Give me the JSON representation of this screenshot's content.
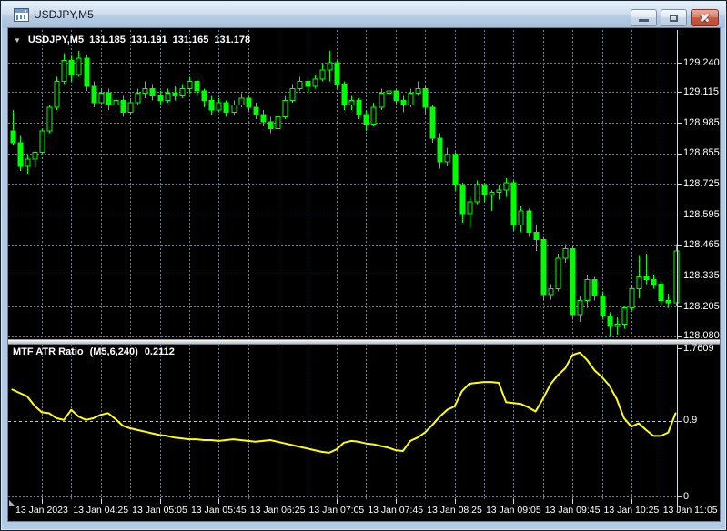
{
  "window": {
    "title": "USDJPY,M5"
  },
  "icons": {
    "app": "chart-window",
    "symbol_dropdown": "▼",
    "minimize": "minimize-bar",
    "restore": "restore-square",
    "close": "close-x"
  },
  "main_chart": {
    "info_bar": {
      "symbol": "USDJPY,M5",
      "open": "131.185",
      "high": "131.191",
      "low": "131.165",
      "close": "131.178"
    }
  },
  "indicator": {
    "name": "MTF ATR Ratio",
    "params": "(M5,6,240)",
    "value": "0.2112"
  },
  "colors": {
    "background": "#000000",
    "candle": "#00ff00",
    "bull_fill": "#000000",
    "bear_fill": "#00ff00",
    "indicator_line": "#ffff00",
    "grid": "#6e8090",
    "level_line": "#c0c6cc",
    "axis_line": "#d4d9dd",
    "axis_text": "#ffffff",
    "titlebar_text": "#15191d",
    "close_button": "#c65940"
  },
  "chart_data": [
    {
      "type": "candlestick",
      "title": "USDJPY,M5",
      "ylabel": "price",
      "y_ticks": [
        "129.240",
        "129.115",
        "128.985",
        "128.855",
        "128.725",
        "128.595",
        "128.465",
        "128.335",
        "128.205",
        "128.080"
      ],
      "x_labels": [
        "13 Jan 2023",
        "13 Jan 04:25",
        "13 Jan 05:05",
        "13 Jan 05:45",
        "13 Jan 06:25",
        "13 Jan 07:05",
        "13 Jan 07:45",
        "13 Jan 08:25",
        "13 Jan 09:05",
        "13 Jan 09:45",
        "13 Jan 10:25",
        "13 Jan 11:05"
      ],
      "grid": true,
      "candles": [
        [
          128.95,
          129.04,
          128.89,
          128.9
        ],
        [
          128.9,
          128.93,
          128.78,
          128.8
        ],
        [
          128.8,
          128.85,
          128.77,
          128.83
        ],
        [
          128.83,
          128.87,
          128.8,
          128.86
        ],
        [
          128.86,
          128.96,
          128.85,
          128.95
        ],
        [
          128.95,
          129.06,
          128.94,
          129.05
        ],
        [
          129.05,
          129.18,
          129.04,
          129.16
        ],
        [
          129.16,
          129.28,
          129.15,
          129.25
        ],
        [
          129.25,
          129.27,
          129.16,
          129.19
        ],
        [
          129.19,
          129.29,
          129.18,
          129.26
        ],
        [
          129.26,
          129.27,
          129.12,
          129.14
        ],
        [
          129.14,
          129.16,
          129.05,
          129.07
        ],
        [
          129.07,
          129.13,
          129.06,
          129.11
        ],
        [
          129.11,
          129.13,
          129.04,
          129.06
        ],
        [
          129.06,
          129.1,
          129.02,
          129.08
        ],
        [
          129.08,
          129.1,
          129.01,
          129.03
        ],
        [
          129.03,
          129.09,
          129.02,
          129.07
        ],
        [
          129.07,
          129.13,
          129.06,
          129.11
        ],
        [
          129.11,
          129.16,
          129.09,
          129.13
        ],
        [
          129.13,
          129.15,
          129.08,
          129.1
        ],
        [
          129.1,
          129.12,
          129.06,
          129.08
        ],
        [
          129.08,
          129.13,
          129.07,
          129.11
        ],
        [
          129.11,
          129.14,
          129.08,
          129.1
        ],
        [
          129.1,
          129.15,
          129.09,
          129.13
        ],
        [
          129.13,
          129.18,
          129.11,
          129.16
        ],
        [
          129.16,
          129.17,
          129.1,
          129.12
        ],
        [
          129.12,
          129.13,
          129.05,
          129.08
        ],
        [
          129.08,
          129.1,
          129.02,
          129.04
        ],
        [
          129.04,
          129.09,
          129.03,
          129.07
        ],
        [
          129.07,
          129.08,
          129.01,
          129.03
        ],
        [
          129.03,
          129.08,
          129.02,
          129.06
        ],
        [
          129.06,
          129.11,
          129.05,
          129.09
        ],
        [
          129.09,
          129.1,
          129.03,
          129.05
        ],
        [
          129.05,
          129.07,
          129.0,
          129.02
        ],
        [
          129.02,
          129.04,
          128.97,
          128.99
        ],
        [
          128.99,
          129.01,
          128.94,
          128.96
        ],
        [
          128.96,
          129.02,
          128.95,
          129.01
        ],
        [
          129.01,
          129.1,
          129.0,
          129.08
        ],
        [
          129.08,
          129.15,
          129.07,
          129.13
        ],
        [
          129.13,
          129.18,
          129.12,
          129.16
        ],
        [
          129.16,
          129.17,
          129.11,
          129.14
        ],
        [
          129.14,
          129.19,
          129.13,
          129.17
        ],
        [
          129.17,
          129.24,
          129.16,
          129.21
        ],
        [
          129.21,
          129.29,
          129.16,
          129.24
        ],
        [
          129.24,
          129.25,
          129.13,
          129.15
        ],
        [
          129.15,
          129.16,
          129.04,
          129.06
        ],
        [
          129.06,
          129.1,
          129.04,
          129.08
        ],
        [
          129.08,
          129.09,
          129.0,
          129.02
        ],
        [
          129.02,
          129.04,
          128.95,
          128.98
        ],
        [
          128.98,
          129.07,
          128.97,
          129.05
        ],
        [
          129.05,
          129.13,
          129.04,
          129.11
        ],
        [
          129.11,
          129.15,
          129.09,
          129.12
        ],
        [
          129.12,
          129.13,
          129.06,
          129.08
        ],
        [
          129.08,
          129.1,
          129.03,
          129.06
        ],
        [
          129.06,
          129.13,
          129.05,
          129.11
        ],
        [
          129.11,
          129.16,
          129.1,
          129.13
        ],
        [
          129.13,
          129.14,
          129.02,
          129.05
        ],
        [
          129.05,
          129.06,
          128.9,
          128.92
        ],
        [
          128.92,
          128.94,
          128.79,
          128.82
        ],
        [
          128.82,
          128.88,
          128.8,
          128.85
        ],
        [
          128.85,
          128.86,
          128.7,
          128.72
        ],
        [
          128.72,
          128.73,
          128.56,
          128.6
        ],
        [
          128.6,
          128.67,
          128.54,
          128.65
        ],
        [
          128.65,
          128.74,
          128.64,
          128.72
        ],
        [
          128.72,
          128.73,
          128.65,
          128.68
        ],
        [
          128.68,
          128.7,
          128.61,
          128.69
        ],
        [
          128.69,
          128.72,
          128.66,
          128.7
        ],
        [
          128.7,
          128.75,
          128.67,
          128.73
        ],
        [
          128.73,
          128.74,
          128.53,
          128.55
        ],
        [
          128.55,
          128.63,
          128.52,
          128.61
        ],
        [
          128.61,
          128.62,
          128.5,
          128.52
        ],
        [
          128.52,
          128.55,
          128.44,
          128.49
        ],
        [
          128.49,
          128.5,
          128.23,
          128.255
        ],
        [
          128.255,
          128.3,
          128.235,
          128.28
        ],
        [
          128.28,
          128.43,
          128.27,
          128.41
        ],
        [
          128.41,
          128.47,
          128.39,
          128.45
        ],
        [
          128.45,
          128.46,
          128.15,
          128.17
        ],
        [
          128.17,
          128.25,
          128.14,
          128.23
        ],
        [
          128.23,
          128.34,
          128.2,
          128.32
        ],
        [
          128.32,
          128.33,
          128.23,
          128.25
        ],
        [
          128.25,
          128.27,
          128.15,
          128.165
        ],
        [
          128.165,
          128.18,
          128.08,
          128.12
        ],
        [
          128.12,
          128.16,
          128.085,
          128.13
        ],
        [
          128.13,
          128.21,
          128.11,
          128.2
        ],
        [
          128.2,
          128.29,
          128.19,
          128.28
        ],
        [
          128.28,
          128.42,
          128.24,
          128.33
        ],
        [
          128.33,
          128.43,
          128.3,
          128.32
        ],
        [
          128.32,
          128.34,
          128.28,
          128.3
        ],
        [
          128.3,
          128.31,
          128.21,
          128.23
        ],
        [
          128.23,
          128.26,
          128.2,
          128.22
        ],
        [
          128.22,
          128.47,
          128.21,
          128.44
        ]
      ]
    },
    {
      "type": "line",
      "title": "MTF ATR Ratio (M5,6,240)",
      "last_value": "0.2112",
      "color": "#ffff00",
      "y_ticks": [
        "1.7609",
        "0.9",
        "0"
      ],
      "level": 0.9,
      "ylim": [
        0,
        1.7609
      ],
      "values": [
        1.27,
        1.23,
        1.19,
        1.08,
        1.0,
        0.99,
        0.93,
        0.91,
        1.03,
        0.95,
        0.91,
        0.93,
        0.97,
        0.99,
        0.92,
        0.84,
        0.81,
        0.79,
        0.77,
        0.75,
        0.73,
        0.72,
        0.7,
        0.69,
        0.68,
        0.68,
        0.67,
        0.67,
        0.66,
        0.67,
        0.68,
        0.67,
        0.66,
        0.65,
        0.66,
        0.67,
        0.65,
        0.63,
        0.61,
        0.59,
        0.57,
        0.55,
        0.53,
        0.52,
        0.56,
        0.64,
        0.66,
        0.65,
        0.63,
        0.62,
        0.6,
        0.58,
        0.55,
        0.54,
        0.66,
        0.7,
        0.76,
        0.85,
        0.95,
        1.03,
        1.07,
        1.25,
        1.34,
        1.35,
        1.36,
        1.36,
        1.35,
        1.12,
        1.11,
        1.1,
        1.06,
        1.01,
        1.16,
        1.33,
        1.44,
        1.52,
        1.68,
        1.71,
        1.62,
        1.5,
        1.42,
        1.32,
        1.16,
        0.93,
        0.83,
        0.87,
        0.79,
        0.72,
        0.72,
        0.76,
        0.99
      ]
    }
  ]
}
